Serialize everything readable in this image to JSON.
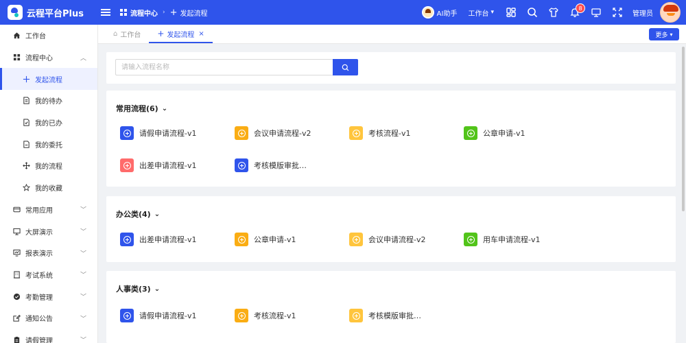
{
  "app": {
    "title": "云程平台Plus"
  },
  "header": {
    "breadcrumb": [
      {
        "label": "流程中心"
      },
      {
        "label": "发起流程"
      }
    ],
    "ai_label": "AI助手",
    "workbench_label": "工作台",
    "notification_count": "8",
    "user_label": "管理员"
  },
  "sidebar": {
    "items": [
      {
        "label": "工作台",
        "icon": "home-icon"
      },
      {
        "label": "流程中心",
        "icon": "grid-icon",
        "expanded": true
      },
      {
        "label": "发起流程",
        "icon": "plus-icon",
        "active": true
      },
      {
        "label": "我的待办",
        "icon": "document-icon"
      },
      {
        "label": "我的已办",
        "icon": "document-check-icon"
      },
      {
        "label": "我的委托",
        "icon": "document-icon"
      },
      {
        "label": "我的流程",
        "icon": "move-icon"
      },
      {
        "label": "我的收藏",
        "icon": "star-icon"
      },
      {
        "label": "常用应用",
        "icon": "card-icon"
      },
      {
        "label": "大屏演示",
        "icon": "monitor-icon"
      },
      {
        "label": "报表演示",
        "icon": "report-icon"
      },
      {
        "label": "考试系统",
        "icon": "building-icon"
      },
      {
        "label": "考勤管理",
        "icon": "check-circle-icon"
      },
      {
        "label": "通知公告",
        "icon": "edit-icon"
      },
      {
        "label": "请假管理",
        "icon": "clipboard-icon"
      }
    ]
  },
  "tabs": [
    {
      "label": "工作台"
    },
    {
      "label": "发起流程",
      "active": true
    }
  ],
  "more_label": "更多",
  "search": {
    "placeholder": "请输入流程名称",
    "value": ""
  },
  "colors": {
    "primary": "#2f54eb",
    "orange": "#faad14",
    "yellow": "#ffc53d",
    "green": "#52c41a",
    "red": "#ff6b6b"
  },
  "categories": [
    {
      "title": "常用流程(6)",
      "items": [
        {
          "label": "请假申请流程-v1",
          "color": "#2f54eb"
        },
        {
          "label": "会议申请流程-v2",
          "color": "#faad14"
        },
        {
          "label": "考核流程-v1",
          "color": "#ffc53d"
        },
        {
          "label": "公章申请-v1",
          "color": "#52c41a"
        },
        {
          "label": "出差申请流程-v1",
          "color": "#ff6b6b"
        },
        {
          "label": "考核模版审批…",
          "color": "#2f54eb"
        }
      ]
    },
    {
      "title": "办公类(4)",
      "items": [
        {
          "label": "出差申请流程-v1",
          "color": "#2f54eb"
        },
        {
          "label": "公章申请-v1",
          "color": "#faad14"
        },
        {
          "label": "会议申请流程-v2",
          "color": "#ffc53d"
        },
        {
          "label": "用车申请流程-v1",
          "color": "#52c41a"
        }
      ]
    },
    {
      "title": "人事类(3)",
      "items": [
        {
          "label": "请假申请流程-v1",
          "color": "#2f54eb"
        },
        {
          "label": "考核流程-v1",
          "color": "#faad14"
        },
        {
          "label": "考核模版审批…",
          "color": "#ffc53d"
        }
      ]
    }
  ]
}
